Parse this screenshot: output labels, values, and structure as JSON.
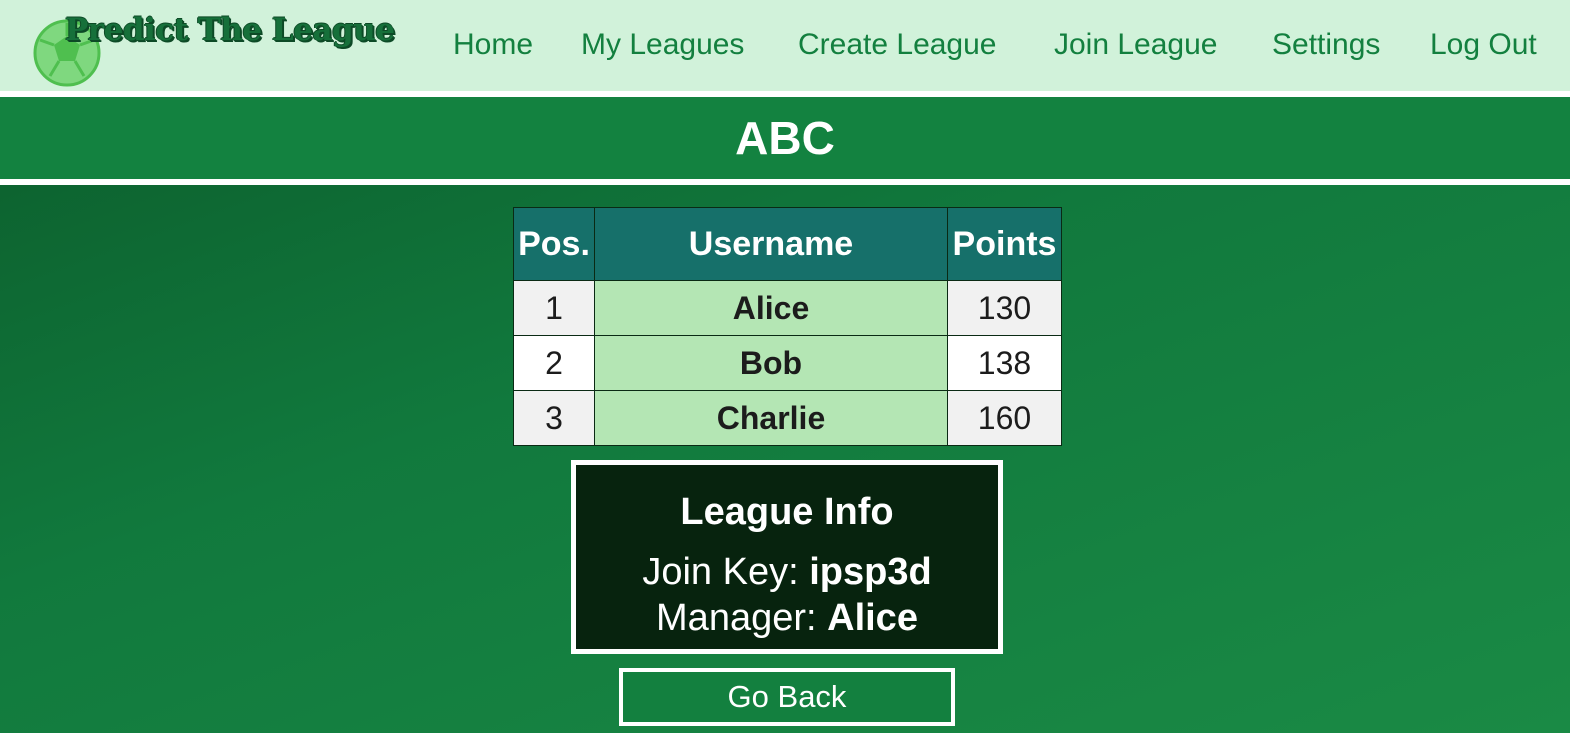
{
  "header": {
    "logo_text": "Predict The League",
    "nav": [
      {
        "label": "Home"
      },
      {
        "label": "My Leagues"
      },
      {
        "label": "Create League"
      },
      {
        "label": "Join League"
      },
      {
        "label": "Settings"
      },
      {
        "label": "Log Out"
      }
    ]
  },
  "league": {
    "name": "ABC"
  },
  "standings": {
    "columns": [
      "Pos.",
      "Username",
      "Points"
    ],
    "rows": [
      {
        "pos": "1",
        "username": "Alice",
        "points": "130"
      },
      {
        "pos": "2",
        "username": "Bob",
        "points": "138"
      },
      {
        "pos": "3",
        "username": "Charlie",
        "points": "160"
      }
    ]
  },
  "info": {
    "title": "League Info",
    "join_key_label": "Join Key: ",
    "join_key": "ipsp3d",
    "manager_label": "Manager: ",
    "manager": "Alice"
  },
  "actions": {
    "go_back": "Go Back"
  },
  "colors": {
    "header_bg": "#d1f2da",
    "nav_text": "#13803f",
    "title_band": "#138240",
    "table_header": "#16706a",
    "username_cell": "#b4e6b4",
    "info_bg": "#07230e"
  }
}
